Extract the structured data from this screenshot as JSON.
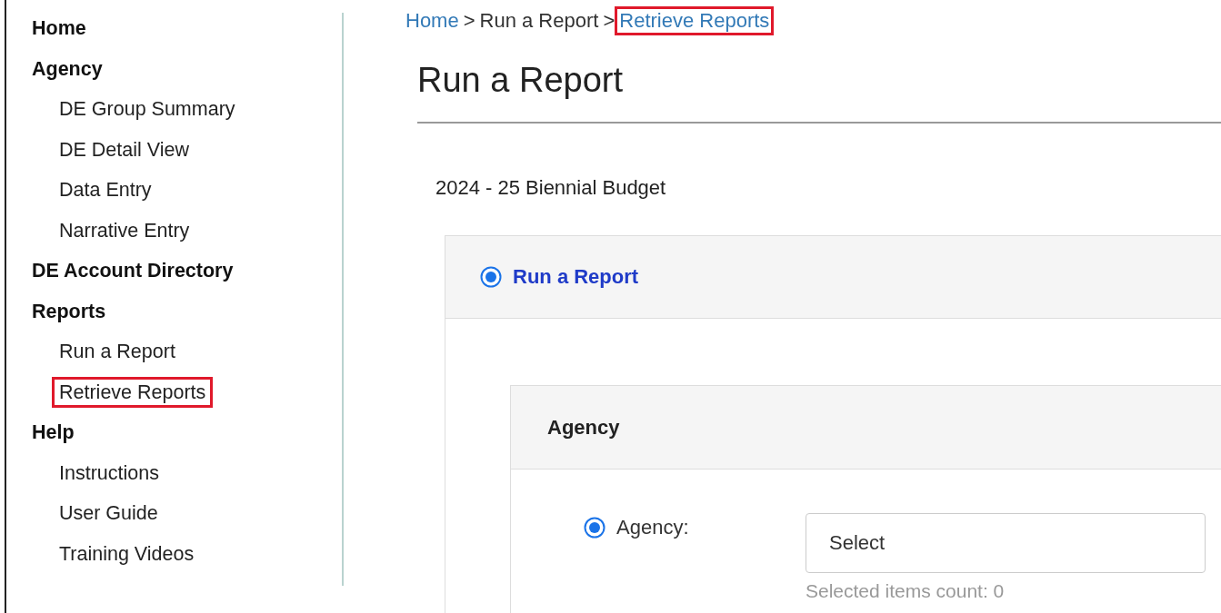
{
  "sidebar": {
    "items": [
      {
        "label": "Home",
        "highlighted": false
      },
      {
        "label": "Agency",
        "highlighted": false,
        "children": [
          {
            "label": "DE Group Summary",
            "highlighted": false
          },
          {
            "label": "DE Detail View",
            "highlighted": false
          },
          {
            "label": "Data Entry",
            "highlighted": false
          },
          {
            "label": "Narrative Entry",
            "highlighted": false
          }
        ]
      },
      {
        "label": "DE Account Directory",
        "highlighted": false
      },
      {
        "label": "Reports",
        "highlighted": false,
        "children": [
          {
            "label": "Run a Report",
            "highlighted": false
          },
          {
            "label": "Retrieve Reports",
            "highlighted": true
          }
        ]
      },
      {
        "label": "Help",
        "highlighted": false,
        "children": [
          {
            "label": "Instructions",
            "highlighted": false
          },
          {
            "label": "User Guide",
            "highlighted": false
          },
          {
            "label": "Training Videos",
            "highlighted": false
          }
        ]
      }
    ]
  },
  "breadcrumb": {
    "separator": ">",
    "items": [
      {
        "label": "Home",
        "kind": "link",
        "highlighted": false
      },
      {
        "label": "Run a Report",
        "kind": "text",
        "highlighted": false
      },
      {
        "label": "Retrieve Reports",
        "kind": "link",
        "highlighted": true
      }
    ]
  },
  "page_title": "Run a Report",
  "budget_label": "2024 - 25 Biennial Budget",
  "report_panel": {
    "title": "Run a Report",
    "selected": true
  },
  "agency_panel": {
    "title": "Agency",
    "field": {
      "label": "Agency:",
      "selected": true,
      "value": "Select",
      "helper": "Selected items count: 0"
    }
  }
}
